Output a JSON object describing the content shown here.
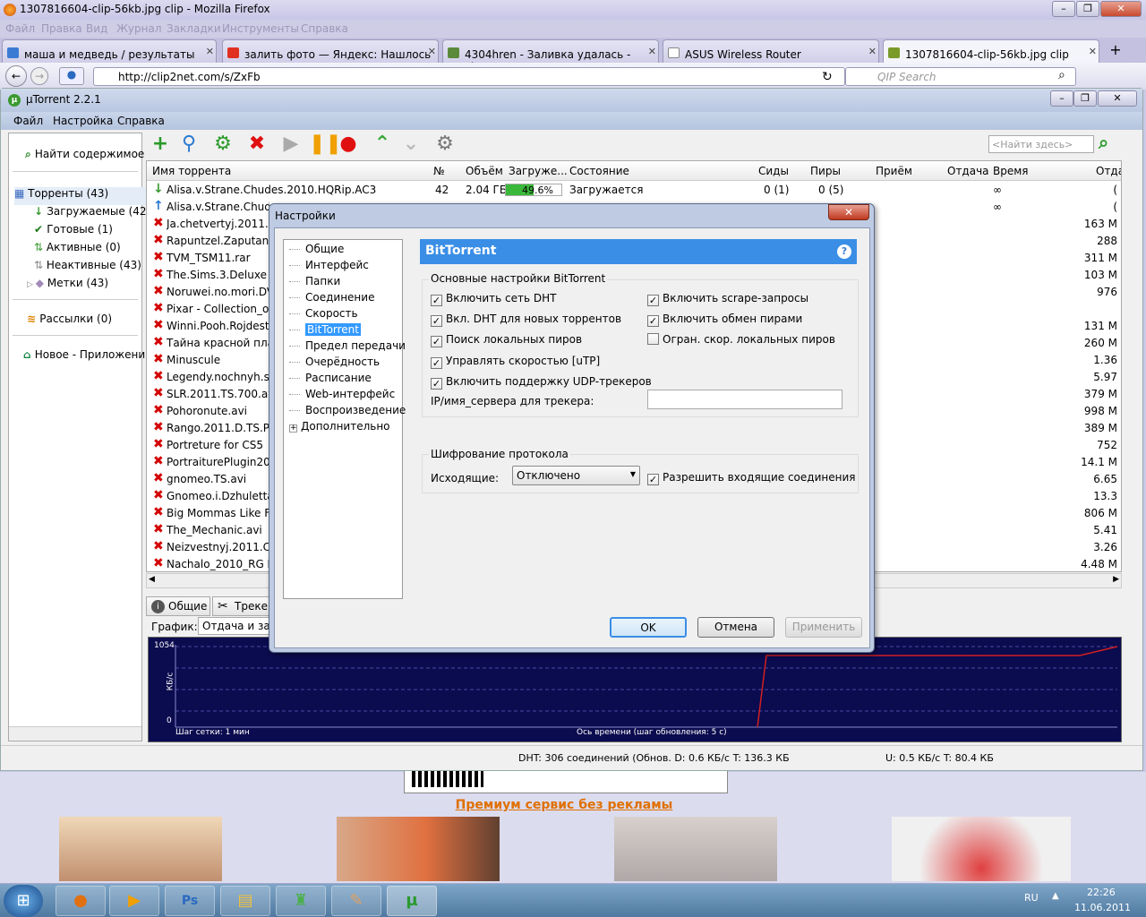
{
  "firefox": {
    "title": "1307816604-clip-56kb.jpg clip - Mozilla Firefox",
    "menu": [
      "Файл",
      "Правка",
      "Вид",
      "Журнал",
      "Закладки",
      "Инструменты",
      "Справка"
    ],
    "tabs": [
      {
        "label": "маша и медведь / результаты поис...",
        "color": "#3b7bd4"
      },
      {
        "label": "залить фото — Яндекс: Нашлось 8 ...",
        "color": "#e03020"
      },
      {
        "label": "4304hren - Заливка удалась - Pictur...",
        "color": "#5a8a3a"
      },
      {
        "label": "ASUS Wireless Router",
        "color": "#ffffff"
      },
      {
        "label": "1307816604-clip-56kb.jpg clip",
        "color": "#7a9a2a"
      }
    ],
    "url": "http://clip2net.com/s/ZxFb",
    "search_placeholder": "QIP Search"
  },
  "page": {
    "premium_link": "Премиум сервис без рекламы"
  },
  "utorrent": {
    "title": "µTorrent 2.2.1",
    "menu": [
      "Файл",
      "Настройка",
      "Справка"
    ],
    "sidebar": {
      "find": "Найти содержимое",
      "torrents": "Торренты (43)",
      "downloading": "Загружаемые (42)",
      "completed": "Готовые (1)",
      "active": "Активные (0)",
      "inactive": "Неактивные (43)",
      "labels": "Метки (43)",
      "rss": "Рассылки (0)",
      "apps": "Новое - Приложения"
    },
    "search_placeholder": "<Найти здесь>",
    "columns": [
      "Имя торрента",
      "№",
      "Объём",
      "Загруже...",
      "Состояние",
      "Сиды",
      "Пиры",
      "Приём",
      "Отдача",
      "Время",
      "Отда"
    ],
    "first_rows": [
      {
        "name": "Alisa.v.Strane.Chudes.2010.HQRip.AC3",
        "num": "42",
        "size": "2.04 ГБ",
        "progress_label": "49.6%",
        "progress": 49.6,
        "status": "Загружается",
        "seeds": "0 (1)",
        "peers": "0 (5)",
        "time": "∞",
        "up": "("
      },
      {
        "name": "Alisa.v.Strane.Chudes",
        "time": "∞",
        "up": "("
      }
    ],
    "rows": [
      {
        "name": "Ja.chetvertyj.2011.Xvi",
        "up": "163 М"
      },
      {
        "name": "Rapuntzel.Zaputanna",
        "up": "288"
      },
      {
        "name": "TVM_TSM11.rar",
        "up": "311 М"
      },
      {
        "name": "The.Sims.3.Deluxe",
        "up": "103 М"
      },
      {
        "name": "Noruwei.no.mori.DVD",
        "up": "976"
      },
      {
        "name": "Pixar - Collection_of_",
        "up": ""
      },
      {
        "name": "Winni.Pooh.Rojdestve",
        "up": "131 М"
      },
      {
        "name": "Тайна красной план",
        "up": "260 М"
      },
      {
        "name": "Minuscule",
        "up": "1.36"
      },
      {
        "name": "Legendy.nochnyh.stra",
        "up": "5.97"
      },
      {
        "name": "SLR.2011.TS.700.avi",
        "up": "379 М"
      },
      {
        "name": "Pohoronute.avi",
        "up": "998 М"
      },
      {
        "name": "Rango.2011.D.TS.PRO",
        "up": "389 М"
      },
      {
        "name": "Portreture for CS5",
        "up": "752"
      },
      {
        "name": "PortraiturePlugin2006",
        "up": "14.1 М"
      },
      {
        "name": "gnomeo.TS.avi",
        "up": "6.65"
      },
      {
        "name": "Gnomeo.i.Dzhuletta.2",
        "up": "13.3"
      },
      {
        "name": "Big Mommas  Like Fa",
        "up": "806 М"
      },
      {
        "name": "The_Mechanic.avi",
        "up": "5.41"
      },
      {
        "name": "Neizvestnyj.2011.CAM",
        "up": "3.26"
      },
      {
        "name": "Nachalo_2010_RG RIP",
        "up": "4.48 М"
      }
    ],
    "bottom_tabs": [
      "Общие",
      "Треке"
    ],
    "graph_label": "График:",
    "graph_select": "Отдача и загр",
    "graph": {
      "ymax": "1054",
      "ymin": "0",
      "yunit": "КБ/с",
      "grid": "Шаг сетки: 1 мин",
      "xaxis": "Ось времени (шаг обновления: 5 с)"
    },
    "status": {
      "dht": "DHT: 306 соединений  (Обнов. D: 0.6 КБ/с T: 136.3 КБ",
      "upload": "U: 0.5 КБ/с T: 80.4 КБ"
    }
  },
  "dialog": {
    "title": "Настройки",
    "tree": [
      "Общие",
      "Интерфейс",
      "Папки",
      "Соединение",
      "Скорость",
      "BitTorrent",
      "Предел передачи",
      "Очерёдность",
      "Расписание",
      "Web-интерфейс",
      "Воспроизведение",
      "Дополнительно"
    ],
    "selected": "BitTorrent",
    "header": "BitTorrent",
    "group1": "Основные настройки BitTorrent",
    "left_checks": [
      {
        "label": "Включить сеть DHT",
        "checked": true
      },
      {
        "label": "Вкл. DHT для новых торрентов",
        "checked": true
      },
      {
        "label": "Поиск локальных пиров",
        "checked": true
      },
      {
        "label": "Управлять скоростью [uTP]",
        "checked": true
      },
      {
        "label": "Включить поддержку UDP-трекеров",
        "checked": true
      }
    ],
    "right_checks": [
      {
        "label": "Включить scrape-запросы",
        "checked": true
      },
      {
        "label": "Включить обмен пирами",
        "checked": true
      },
      {
        "label": "Огран. скор. локальных пиров",
        "checked": false
      }
    ],
    "ip_label": "IP/имя_сервера для трекера:",
    "ip_value": "",
    "group2": "Шифрование протокола",
    "outgoing_label": "Исходящие:",
    "outgoing_value": "Отключено",
    "incoming_label": "Разрешить входящие соединения",
    "buttons": {
      "ok": "OK",
      "cancel": "Отмена",
      "apply": "Применить"
    }
  },
  "taskbar": {
    "lang": "RU",
    "time": "22:26",
    "date": "11.06.2011"
  }
}
